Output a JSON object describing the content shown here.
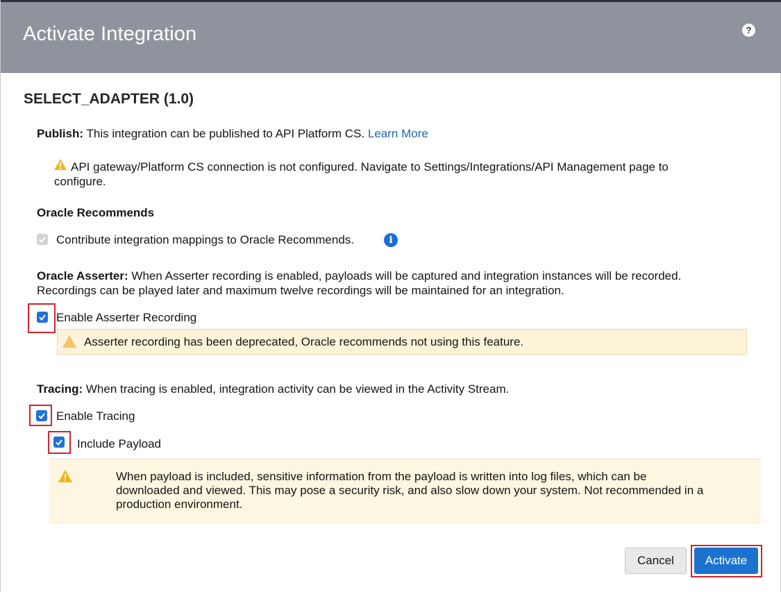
{
  "header": {
    "title": "Activate Integration",
    "help_label": "?"
  },
  "integration": {
    "name": "SELECT_ADAPTER (1.0)"
  },
  "publish": {
    "label": "Publish:",
    "text": "This integration can be published to API Platform CS.",
    "link": "Learn More",
    "warning_line1": "API gateway/Platform CS connection is not configured. Navigate to Settings/Integrations/API Management page to",
    "warning_line2": "configure."
  },
  "recommends": {
    "heading": "Oracle Recommends",
    "checkbox_label": "Contribute integration mappings to Oracle Recommends.",
    "checked": true,
    "disabled": true,
    "info_label": "i"
  },
  "asserter": {
    "label": "Oracle Asserter:",
    "text_line1": "When Asserter recording is enabled, payloads will be captured and integration instances will be recorded.",
    "text_line2": "Recordings can be played later and maximum twelve recordings will be maintained for an integration.",
    "checkbox_label": "Enable Asserter Recording",
    "checked": true,
    "deprecation_warning": "Asserter recording has been deprecated, Oracle recommends not using this feature."
  },
  "tracing": {
    "label": "Tracing:",
    "text": "When tracing is enabled, integration activity can be viewed in the Activity Stream.",
    "enable_label": "Enable Tracing",
    "enable_checked": true,
    "payload_label": "Include Payload",
    "payload_checked": true,
    "payload_warning_line1": "When payload is included, sensitive information from the payload is written into log files, which can be",
    "payload_warning_line2": "downloaded and viewed. This may pose a security risk, and also slow down your system. Not recommended in a",
    "payload_warning_line3": "production environment."
  },
  "footer": {
    "cancel_label": "Cancel",
    "activate_label": "Activate"
  },
  "colors": {
    "header_bg": "#8f939d",
    "accent": "#1b73cf",
    "highlight": "#d2232a",
    "warning_bg": "#fdf3d9",
    "warning_icon": "#f3b51c"
  },
  "icons": {
    "help": "question-icon",
    "warning": "warning-triangle-icon",
    "info": "info-icon",
    "check": "checkmark-icon"
  }
}
